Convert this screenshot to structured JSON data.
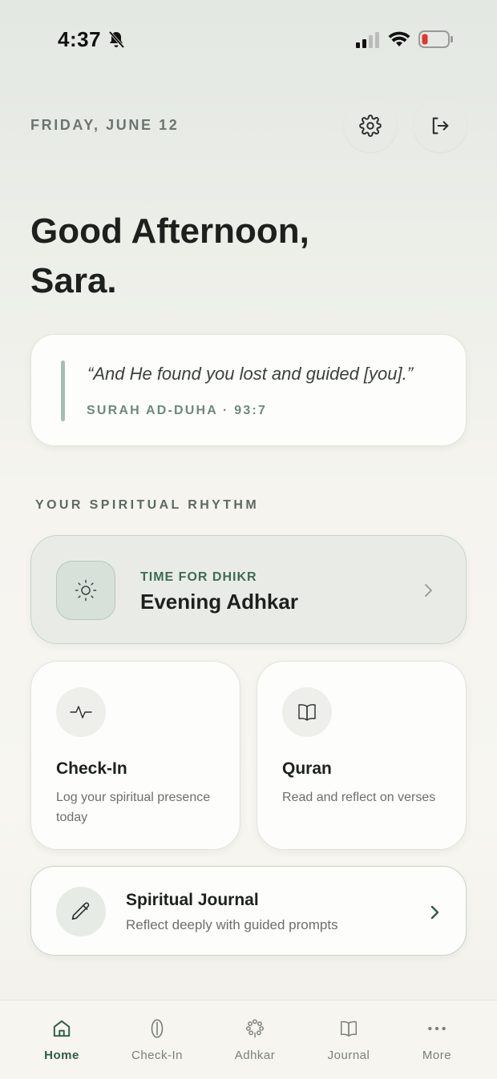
{
  "status_bar": {
    "time": "4:37",
    "icons": [
      "bell-slash-icon",
      "cellular-signal-icon",
      "wifi-icon",
      "battery-low-icon"
    ]
  },
  "header": {
    "date": "FRIDAY, JUNE 12",
    "greeting_line1": "Good Afternoon,",
    "greeting_line2": "Sara.",
    "buttons": [
      "settings-icon",
      "logout-icon"
    ]
  },
  "verse": {
    "text": "“And He found you lost and guided [you].”",
    "reference": "SURAH AD-DUHA · 93:7"
  },
  "rhythm": {
    "section_title": "YOUR SPIRITUAL RHYTHM",
    "dhikr": {
      "eyebrow": "TIME FOR DHIKR",
      "title": "Evening Adhkar",
      "icon": "sun-icon"
    },
    "checkin": {
      "title": "Check-In",
      "subtitle": "Log your spiritual presence today",
      "icon": "pulse-icon"
    },
    "quran": {
      "title": "Quran",
      "subtitle": "Read and reflect on verses",
      "icon": "book-icon"
    },
    "journal": {
      "title": "Spiritual Journal",
      "subtitle": "Reflect deeply with guided prompts",
      "icon": "pencil-icon"
    }
  },
  "tabs": [
    {
      "label": "Home",
      "icon": "home-icon",
      "active": true
    },
    {
      "label": "Check-In",
      "icon": "leaf-icon",
      "active": false
    },
    {
      "label": "Adhkar",
      "icon": "prayer-beads-icon",
      "active": false
    },
    {
      "label": "Journal",
      "icon": "book-open-icon",
      "active": false
    },
    {
      "label": "More",
      "icon": "more-dots-icon",
      "active": false
    }
  ],
  "colors": {
    "accent": "#2e5c45",
    "accent_soft": "#6d8a7a",
    "card": "#fdfdfb",
    "battery_low": "#e5332e"
  }
}
